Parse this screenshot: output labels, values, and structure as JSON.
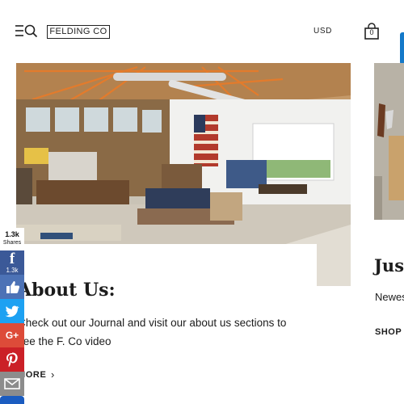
{
  "header": {
    "logo": "FELDING CO",
    "currency": "USD",
    "cart_count": "0",
    "menu_icon": "hamburger-search-icon",
    "cart_icon": "shopping-bag-icon"
  },
  "hero": {
    "image": "store-interior-photo",
    "title": "About Us:",
    "body": "Check out our Journal and visit our about us sections to see the F. Co video",
    "link_label": "MORE",
    "link_icon": "chevron-right-icon"
  },
  "next_card": {
    "image": "product-photo",
    "title": "Just",
    "text": "Newes",
    "link_label": "SHOP N"
  },
  "share_bar": {
    "total": "1.3k",
    "total_label": "Shares",
    "facebook_glyph": "f",
    "facebook_count": "1.3k",
    "google_glyph": "G+",
    "buttons": [
      "facebook-icon",
      "like-icon",
      "twitter-icon",
      "google-plus-icon",
      "pinterest-icon",
      "email-icon",
      "more-share-icon"
    ]
  },
  "colors": {
    "facebook": "#3b5998",
    "like": "#4c72b6",
    "twitter": "#1da1f2",
    "google": "#dd4b39",
    "pinterest": "#cb2027",
    "email": "#8c8c8c",
    "accent": "#1479c9"
  }
}
